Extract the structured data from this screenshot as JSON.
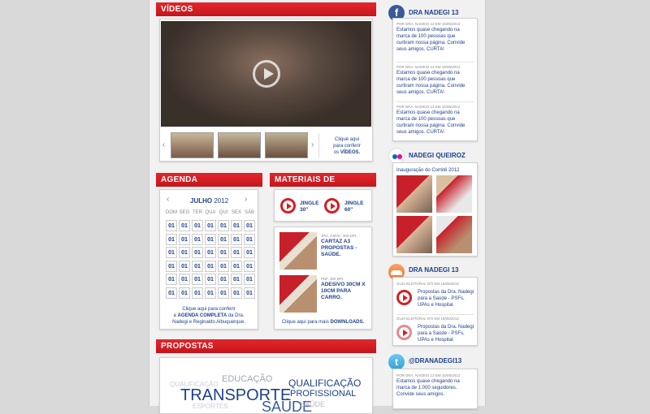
{
  "videos": {
    "header": "VÍDEOS",
    "prev_arrow": "‹",
    "next_arrow": "›",
    "cta_line1": "Clique aqui",
    "cta_line2": "para conferir",
    "cta_line3": "os",
    "cta_bold": "VÍDEOS."
  },
  "agenda": {
    "header": "AGENDA",
    "month": "JULHO",
    "year": "2012",
    "days": [
      "DOM",
      "SEG",
      "TER",
      "QUA",
      "QUI",
      "SEX",
      "SÁB"
    ],
    "cell_value": "01",
    "footer_1": "Clique aqui para conferir",
    "footer_2a": "a",
    "footer_2b": "AGENDA COMPLETA",
    "footer_2c": "da Dra.",
    "footer_3": "Nadegi e Reginaldo Albuquerque."
  },
  "materiais": {
    "header": "MATERIAIS DE CAMPANHA",
    "jingle1": "JINGLE",
    "jingle1_len": "30''",
    "jingle2": "JINGLE",
    "jingle2_len": "60''",
    "item1_meta": "JPG, CMYK, 300 DPI.",
    "item1_title": "CARTAZ A3 PROPOSTAS - SAÚDE.",
    "item2_meta": "PDF, 300 DPI.",
    "item2_title": "ADESIVO 30CM X 10CM PARA CARRO.",
    "downloads_pre": "Clique aqui para mais",
    "downloads_bold": "DOWNLOADS."
  },
  "propostas": {
    "header": "PROPOSTAS",
    "words": [
      "QUALIFICAÇÃO",
      "EDUCAÇÃO",
      "QUALIFICAÇÃO",
      "PROFISSIONAL",
      "TRANSPORTE",
      "SAÚDE",
      "SAÚDE",
      "ESPORTES"
    ]
  },
  "facebook": {
    "title": "DRA NADEGI 13",
    "posts": [
      {
        "meta": "POR DRA. NADEGI 13 EM 15/05/2012",
        "text": "Estamos quase chegando na marca de 100 pessoas que curtiram nossa página. Convide seus amigos. CURTA!"
      },
      {
        "meta": "POR DRA. NADEGI 13 EM 15/05/2012",
        "text": "Estamos quase chegando na marca de 100 pessoas que curtiram nossa página. Convide seus amigos. CURTA!"
      },
      {
        "meta": "POR DRA. NADEGI 13 EM 15/05/2012",
        "text": "Estamos quase chegando na marca de 100 pessoas que curtiram nossa página. Convide seus amigos. CURTA!"
      }
    ]
  },
  "flickr": {
    "title": "NADEGI QUEIROZ",
    "album": "Inauguração do Comitê 2012"
  },
  "soundcloud": {
    "title": "DRA NADEGI 13",
    "items": [
      {
        "meta": "GUIA ELEITORAL Nº2 EM 15/05/2012",
        "text": "Propostas da Dra. Nadegi para a Saúde - PSFs, UPAs e Hospital."
      },
      {
        "meta": "GUIA ELEITORAL Nº2 EM 15/05/2012",
        "text": "Propostas da Dra. Nadegi para a Saúde - PSFs, UPAs e Hospital."
      }
    ]
  },
  "twitter": {
    "title": "@DRANADEGI13",
    "meta": "POR DRA. NADEGI 13 EM 15/05/2012",
    "text": "Estamos quase chegando na marca de 1.000 seguidores. Convide seus amigos."
  }
}
